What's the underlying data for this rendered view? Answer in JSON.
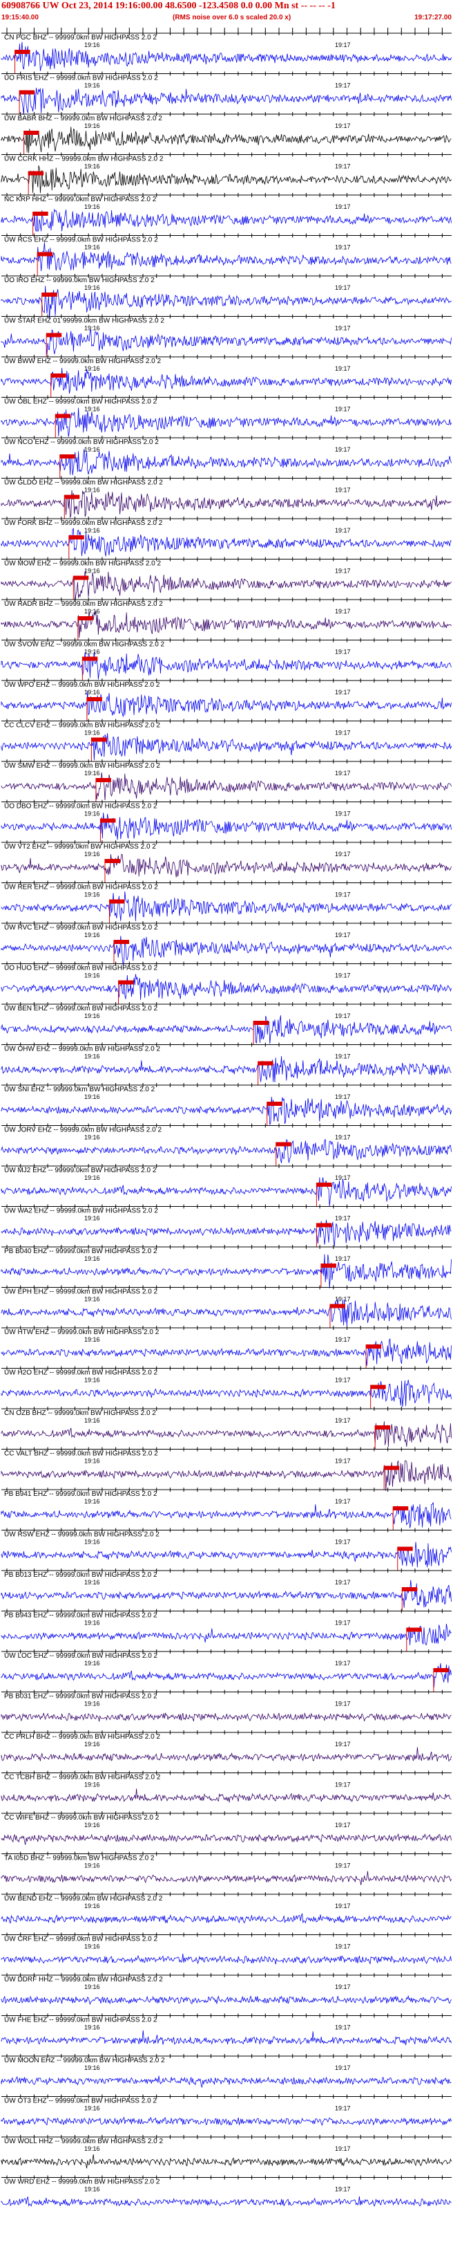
{
  "header": {
    "title": "60908766 UW Oct 23, 2014 19:16:00.00   48.6500 -123.4508  0.0 0.00 Mn st -- -- -- -1",
    "start_time": "19:15:40.00",
    "note": "(RMS noise over 6.0 s scaled 20.0 x)",
    "end_time": "19:17:27.00"
  },
  "colors": {
    "header_text": "#d10000",
    "trace_blue": "#0000ee",
    "trace_purple": "#330066",
    "trace_black": "#000000",
    "pick_red": "#dd0000"
  },
  "time_labels": {
    "t1": "19:16",
    "t2": "19:17"
  },
  "traces": [
    {
      "label": "CN PGC BHZ -- 99999.0km BW HIGHPASS  2.0  2",
      "color": "blue",
      "pick": 0.03
    },
    {
      "label": "UO FRIS EHZ -- 99999.0km BW HIGHPASS  2.0  2",
      "color": "blue",
      "pick": 0.04
    },
    {
      "label": "UW BABR BHZ -- 99999.0km BW HIGHPASS  2.0  2",
      "color": "black",
      "pick": 0.05
    },
    {
      "label": "UW CCRK HHZ -- 99999.0km BW HIGHPASS  2.0  2",
      "color": "black",
      "pick": 0.06
    },
    {
      "label": "NC KRP HHZ -- 99999.0km BW HIGHPASS  2.0  2",
      "color": "blue",
      "pick": 0.07
    },
    {
      "label": "UW RCS EHZ -- 99999.0km BW HIGHPASS  2.0  2",
      "color": "blue",
      "pick": 0.08
    },
    {
      "label": "UO IRO EHZ -- 99999.0km BW HIGHPASS  2.0  2",
      "color": "blue",
      "pick": 0.09
    },
    {
      "label": "UW STAR EHZ 01 99999.0km BW HIGHPASS  2.0  2",
      "color": "blue",
      "pick": 0.1
    },
    {
      "label": "UW BWW EHZ -- 99999.0km BW HIGHPASS  2.0  2",
      "color": "blue",
      "pick": 0.11
    },
    {
      "label": "UW OBL EHZ -- 99999.0km BW HIGHPASS  2.0  2",
      "color": "blue",
      "pick": 0.12
    },
    {
      "label": "UW NCO EHZ -- 99999.0km BW HIGHPASS  2.0  2",
      "color": "blue",
      "pick": 0.13
    },
    {
      "label": "UW GLDO EHZ -- 99999.0km BW HIGHPASS  2.0  2",
      "color": "purple",
      "pick": 0.14
    },
    {
      "label": "UW FORK BHZ -- 99999.0km BW HIGHPASS  2.0  2",
      "color": "blue",
      "pick": 0.15
    },
    {
      "label": "UW MOW EHZ -- 99999.0km BW HIGHPASS  2.0  2",
      "color": "purple",
      "pick": 0.16
    },
    {
      "label": "UW RADR BHZ -- 99999.0km BW HIGHPASS  2.0  2",
      "color": "purple",
      "pick": 0.17
    },
    {
      "label": "UW SVOW EHZ -- 99999.0km BW HIGHPASS  2.0  2",
      "color": "blue",
      "pick": 0.18
    },
    {
      "label": "UW WPO EHZ -- 99999.0km BW HIGHPASS  2.0  2",
      "color": "blue",
      "pick": 0.19
    },
    {
      "label": "CC CLCV EHZ -- 99999.0km BW HIGHPASS  2.0  2",
      "color": "blue",
      "pick": 0.2
    },
    {
      "label": "UW SMW EHZ -- 99999.0km BW HIGHPASS  2.0  2",
      "color": "purple",
      "pick": 0.21
    },
    {
      "label": "UO DBO EHZ -- 99999.0km BW HIGHPASS  2.0  2",
      "color": "blue",
      "pick": 0.22
    },
    {
      "label": "UW VT2 EHZ -- 99999.0km BW HIGHPASS  2.0  2",
      "color": "purple",
      "pick": 0.23
    },
    {
      "label": "UW RER EHZ -- 99999.0km BW HIGHPASS  2.0  2",
      "color": "blue",
      "pick": 0.24
    },
    {
      "label": "UW RVC EHZ -- 99999.0km BW HIGHPASS  2.0  2",
      "color": "blue",
      "pick": 0.25
    },
    {
      "label": "UO HUO EHZ -- 99999.0km BW HIGHPASS  2.0  2",
      "color": "blue",
      "pick": 0.26
    },
    {
      "label": "UW BEN EHZ -- 99999.0km BW HIGHPASS  2.0  2",
      "color": "blue",
      "pick": 0.56
    },
    {
      "label": "UW OHW EHZ -- 99999.0km BW HIGHPASS  2.0  2",
      "color": "blue",
      "pick": 0.57
    },
    {
      "label": "UW SNI EHZ -- 99999.0km BW HIGHPASS  2.0  2",
      "color": "blue",
      "pick": 0.59
    },
    {
      "label": "UW JORV EHZ -- 99999.0km BW HIGHPASS  2.0  2",
      "color": "blue",
      "pick": 0.61
    },
    {
      "label": "UW MJ2 EHZ -- 99999.0km BW HIGHPASS  2.0  2",
      "color": "blue",
      "pick": 0.7
    },
    {
      "label": "UW WA2 EHZ -- 99999.0km BW HIGHPASS  2.0  2",
      "color": "blue",
      "pick": 0.7
    },
    {
      "label": "PB B040 EHZ -- 99999.0km BW HIGHPASS  2.0  2",
      "color": "blue",
      "pick": 0.71
    },
    {
      "label": "UW EPH EHZ -- 99999.0km BW HIGHPASS  2.0  2",
      "color": "blue",
      "pick": 0.73
    },
    {
      "label": "UW HTW EHZ -- 99999.0km BW HIGHPASS  2.0  2",
      "color": "blue",
      "pick": 0.81
    },
    {
      "label": "UW H2O EHZ -- 99999.0km BW HIGHPASS  2.0  2",
      "color": "blue",
      "pick": 0.82
    },
    {
      "label": "CN OZB BHZ -- 99999.0km BW HIGHPASS  2.0  2",
      "color": "purple",
      "pick": 0.83
    },
    {
      "label": "CC VALT BHZ -- 99999.0km BW HIGHPASS  2.0  2",
      "color": "purple",
      "pick": 0.85
    },
    {
      "label": "PB B941 EHZ -- 99999.0km BW HIGHPASS  2.0  2",
      "color": "blue",
      "pick": 0.87
    },
    {
      "label": "UW RSW EHZ -- 99999.0km BW HIGHPASS  2.0  2",
      "color": "blue",
      "pick": 0.88
    },
    {
      "label": "PB B013 EHZ -- 99999.0km BW HIGHPASS  2.0  2",
      "color": "blue",
      "pick": 0.89
    },
    {
      "label": "PB B943 EHZ -- 99999.0km BW HIGHPASS  2.0  2",
      "color": "blue",
      "pick": 0.9
    },
    {
      "label": "UW LOC EHZ -- 99999.0km BW HIGHPASS  2.0  2",
      "color": "blue",
      "pick": 0.96
    },
    {
      "label": "PB B031 EHZ -- 99999.0km BW HIGHPASS  2.0  2",
      "color": "purple",
      "pick": null
    },
    {
      "label": "CC PRLH BHZ -- 99999.0km BW HIGHPASS  2.0  2",
      "color": "purple",
      "pick": null
    },
    {
      "label": "CC TCBH BHZ -- 99999.0km BW HIGHPASS  2.0  2",
      "color": "purple",
      "pick": null
    },
    {
      "label": "CC WIFE BHZ -- 99999.0km BW HIGHPASS  2.0  2",
      "color": "purple",
      "pick": null
    },
    {
      "label": "TA I05D BHZ -- 99999.0km BW HIGHPASS  2.0  2",
      "color": "purple",
      "pick": null
    },
    {
      "label": "UW BEND EHZ -- 99999.0km BW HIGHPASS  2.0  2",
      "color": "blue",
      "pick": null
    },
    {
      "label": "UW CRF EHZ -- 99999.0km BW HIGHPASS  2.0  2",
      "color": "blue",
      "pick": null
    },
    {
      "label": "UW DDRF HHZ -- 99999.0km BW HIGHPASS  2.0  2",
      "color": "blue",
      "pick": null
    },
    {
      "label": "UW FHE EHZ -- 99999.0km BW HIGHPASS  2.0  2",
      "color": "blue",
      "pick": null
    },
    {
      "label": "UW MOON EHZ -- 99999.0km BW HIGHPASS  2.0  2",
      "color": "blue",
      "pick": null
    },
    {
      "label": "UW OT3 EHZ -- 99999.0km BW HIGHPASS  2.0  2",
      "color": "blue",
      "pick": null
    },
    {
      "label": "UW WOLL HHZ -- 99999.0km BW HIGHPASS  2.0  2",
      "color": "black",
      "pick": null
    },
    {
      "label": "UW WRD EHZ -- 99999.0km BW HIGHPASS  2.0  2",
      "color": "blue",
      "pick": null
    }
  ]
}
